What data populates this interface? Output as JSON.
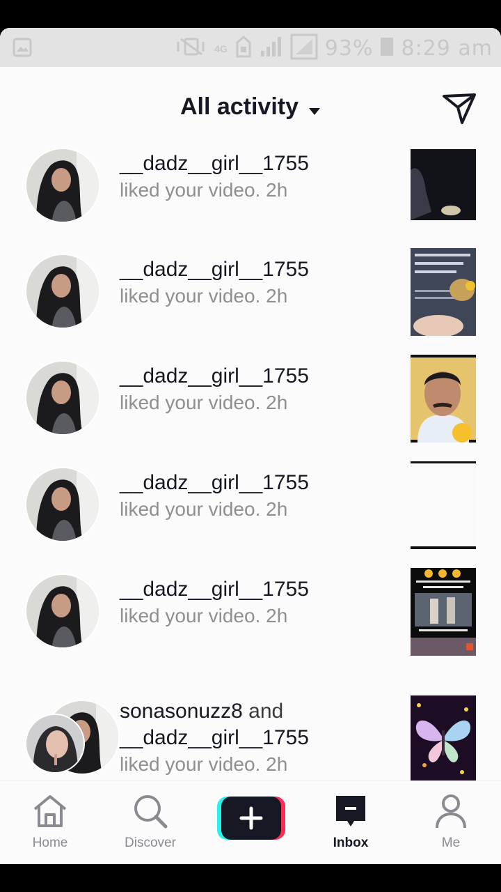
{
  "status_bar": {
    "signal_label": "4G",
    "battery": "93%",
    "time": "8:29 am"
  },
  "header": {
    "title": "All activity",
    "title_icon": "caret-down-icon",
    "action_icon": "send-message-icon"
  },
  "activity": [
    {
      "username": "__dadz__girl__1755",
      "connector": "",
      "username2": "",
      "action": "liked your video.",
      "time": "2h"
    },
    {
      "username": "__dadz__girl__1755",
      "connector": "",
      "username2": "",
      "action": "liked your video.",
      "time": "2h"
    },
    {
      "username": "__dadz__girl__1755",
      "connector": "",
      "username2": "",
      "action": "liked your video.",
      "time": "2h"
    },
    {
      "username": "__dadz__girl__1755",
      "connector": "",
      "username2": "",
      "action": "liked your video.",
      "time": "2h"
    },
    {
      "username": "__dadz__girl__1755",
      "connector": "",
      "username2": "",
      "action": "liked your video.",
      "time": "2h"
    },
    {
      "username": "sonasonuzz8",
      "connector": "and",
      "username2": "__dadz__girl__1755",
      "action": "liked your video.",
      "time": "2h"
    }
  ],
  "tabs": [
    {
      "label": "Home",
      "icon": "home-icon"
    },
    {
      "label": "Discover",
      "icon": "search-icon"
    },
    {
      "label": "",
      "icon": "plus-icon"
    },
    {
      "label": "Inbox",
      "icon": "inbox-icon"
    },
    {
      "label": "Me",
      "icon": "person-icon"
    }
  ],
  "colors": {
    "text_primary": "#161823",
    "text_secondary": "#8f8f91",
    "create_cyan": "#25f4ee",
    "create_red": "#fe2c55"
  }
}
